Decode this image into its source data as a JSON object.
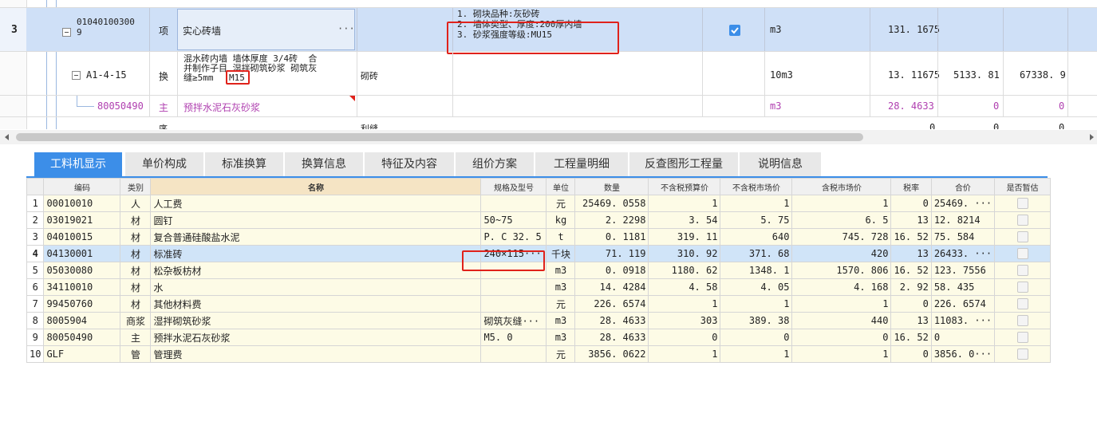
{
  "top": {
    "row_above": {
      "name_partial": "……"
    },
    "row3": {
      "rownum": "3",
      "code_line1": "01040100300",
      "code_line2": "9",
      "type": "项",
      "name": "实心砖墙",
      "more": "···",
      "feature_line1": "1. 砌块品种:灰砂砖",
      "feature_line2": "2. 墙体类型、厚度:200厚内墙",
      "feature_line3": "3. 砂浆强度等级:MU15",
      "unit": "m3",
      "qty": "131. 1675"
    },
    "row_a1": {
      "code": "A1-4-15",
      "type": "换",
      "name_line1": "混水砖内墙 墙体厚度 3/4砖  合",
      "name_line2": "并制作子目 湿拌砌筑砂浆 砌筑灰",
      "name_line3": "缝≥5mm ",
      "name_highlight": "M15",
      "spec": "砌砖",
      "unit": "10m3",
      "qty": "13. 11675",
      "price": "5133. 81",
      "total": "67338. 9"
    },
    "row_800": {
      "code": "80050490",
      "type": "主",
      "name": "预拌水泥石灰砂浆",
      "unit": "m3",
      "qty": "28. 4633",
      "price": "0",
      "total": "0"
    },
    "row_partial": {
      "type": "序",
      "spec": "利缝",
      "v1": "0",
      "v2": "0",
      "v3": "0"
    }
  },
  "tabs": [
    {
      "label": "工料机显示",
      "active": true
    },
    {
      "label": "单价构成"
    },
    {
      "label": "标准换算"
    },
    {
      "label": "换算信息"
    },
    {
      "label": "特征及内容"
    },
    {
      "label": "组价方案"
    },
    {
      "label": "工程量明细"
    },
    {
      "label": "反查图形工程量"
    },
    {
      "label": "说明信息"
    }
  ],
  "table": {
    "headers": [
      "编码",
      "类别",
      "名称",
      "规格及型号",
      "单位",
      "数量",
      "不含税预算价",
      "不含税市场价",
      "含税市场价",
      "税率",
      "合价",
      "是否暂估"
    ],
    "rows": [
      {
        "n": "1",
        "code": "00010010",
        "cat": "人",
        "name": "人工费",
        "spec": "",
        "unit": "元",
        "qty": "25469. 0558",
        "p1": "1",
        "p2": "1",
        "p3": "1",
        "tax": "0",
        "total": "25469. ···"
      },
      {
        "n": "2",
        "code": "03019021",
        "cat": "材",
        "name": "圆钉",
        "spec": "50~75",
        "unit": "kg",
        "qty": "2. 2298",
        "p1": "3. 54",
        "p2": "5. 75",
        "p3": "6. 5",
        "tax": "13",
        "total": "12. 8214"
      },
      {
        "n": "3",
        "code": "04010015",
        "cat": "材",
        "name": "复合普通硅酸盐水泥",
        "spec": "P. C 32. 5",
        "unit": "t",
        "qty": "0. 1181",
        "p1": "319. 11",
        "p2": "640",
        "p3": "745. 728",
        "tax": "16. 52",
        "total": "75. 584"
      },
      {
        "n": "4",
        "code": "04130001",
        "cat": "材",
        "name": "标准砖",
        "spec": "240×115···",
        "unit": "千块",
        "qty": "71. 119",
        "p1": "310. 92",
        "p2": "371. 68",
        "p3": "420",
        "tax": "13",
        "total": "26433. ···"
      },
      {
        "n": "5",
        "code": "05030080",
        "cat": "材",
        "name": "松杂板枋材",
        "spec": "",
        "unit": "m3",
        "qty": "0. 0918",
        "p1": "1180. 62",
        "p2": "1348. 1",
        "p3": "1570. 806",
        "tax": "16. 52",
        "total": "123. 7556"
      },
      {
        "n": "6",
        "code": "34110010",
        "cat": "材",
        "name": "水",
        "spec": "",
        "unit": "m3",
        "qty": "14. 4284",
        "p1": "4. 58",
        "p2": "4. 05",
        "p3": "4. 168",
        "tax": "2. 92",
        "total": "58. 435"
      },
      {
        "n": "7",
        "code": "99450760",
        "cat": "材",
        "name": "其他材料费",
        "spec": "",
        "unit": "元",
        "qty": "226. 6574",
        "p1": "1",
        "p2": "1",
        "p3": "1",
        "tax": "0",
        "total": "226. 6574"
      },
      {
        "n": "8",
        "code": "8005904",
        "cat": "商浆",
        "name": "湿拌砌筑砂浆",
        "spec": "砌筑灰缝···",
        "unit": "m3",
        "qty": "28. 4633",
        "p1": "303",
        "p2": "389. 38",
        "p3": "440",
        "tax": "13",
        "total": "11083. ···"
      },
      {
        "n": "9",
        "code": "80050490",
        "cat": "主",
        "name": "预拌水泥石灰砂浆",
        "spec": "M5. 0",
        "unit": "m3",
        "qty": "28. 4633",
        "p1": "0",
        "p2": "0",
        "p3": "0",
        "tax": "16. 52",
        "total": "0"
      },
      {
        "n": "10",
        "code": "GLF",
        "cat": "管",
        "name": "管理费",
        "spec": "",
        "unit": "元",
        "qty": "3856. 0622",
        "p1": "1",
        "p2": "1",
        "p3": "1",
        "tax": "0",
        "total": "3856. 0···"
      }
    ]
  },
  "colors": {
    "accent": "#3c8ee8",
    "selected": "#cfe0f7",
    "highlight": "#e0221b",
    "main_material": "#b040b0"
  }
}
